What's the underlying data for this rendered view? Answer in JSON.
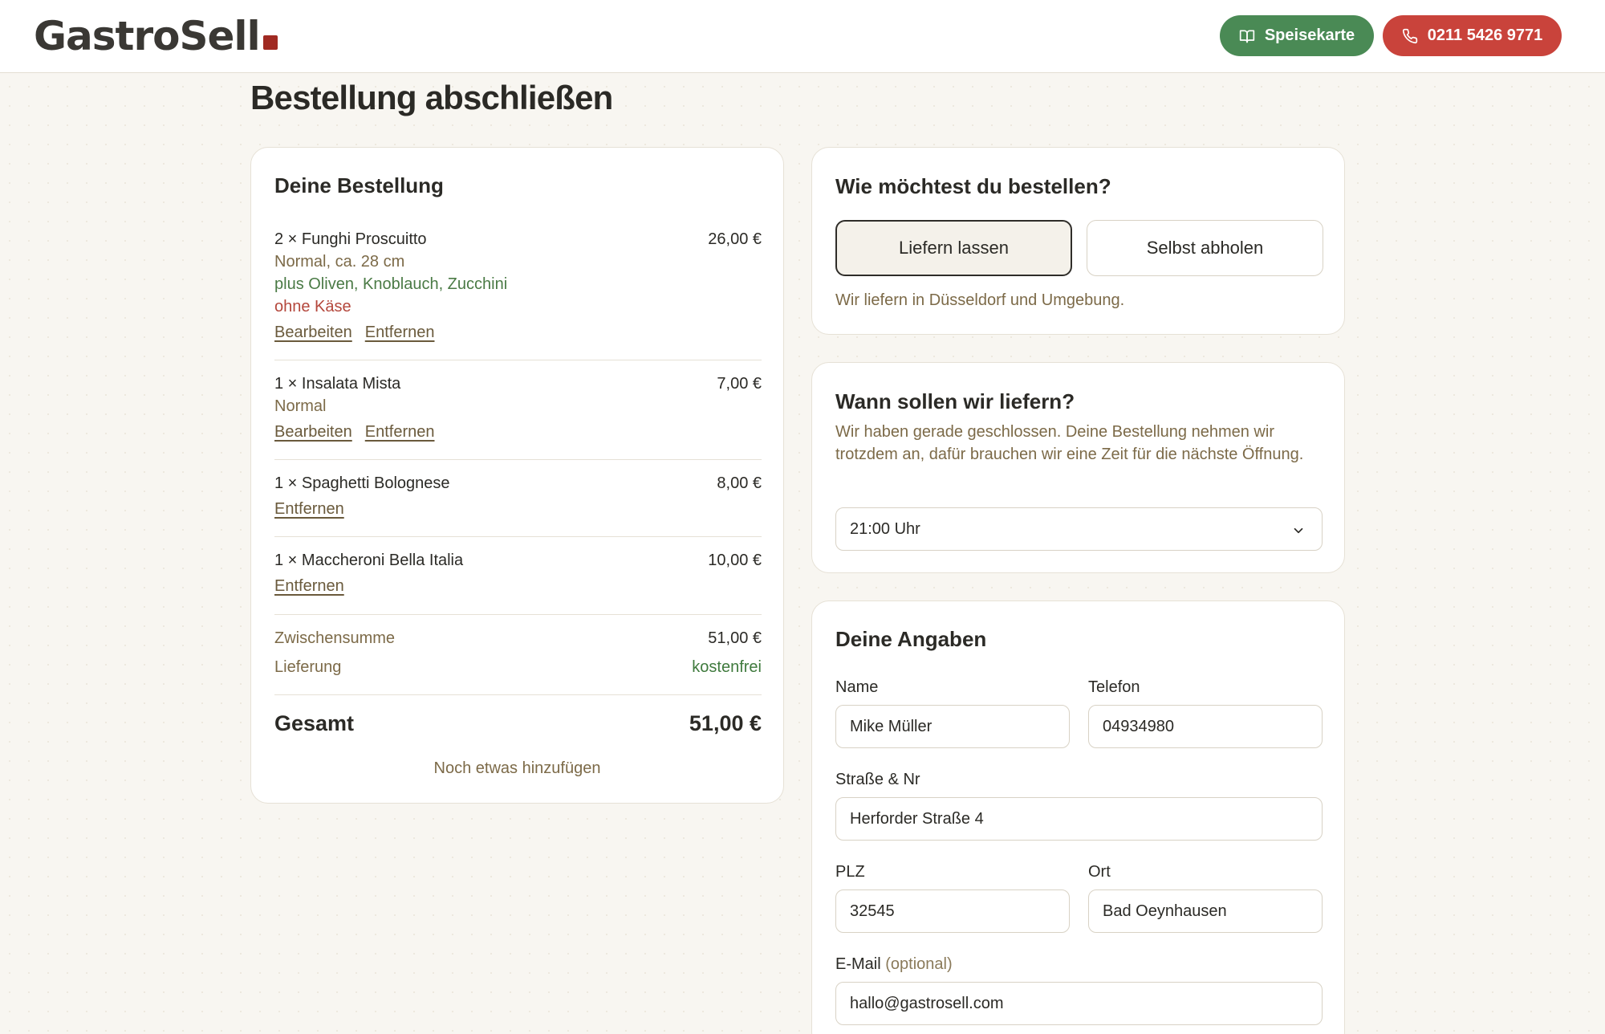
{
  "header": {
    "logo_text": "GastroSell",
    "menu_button": "Speisekarte",
    "phone_button": "0211 5426 9771"
  },
  "page": {
    "title": "Bestellung abschließen"
  },
  "order": {
    "title": "Deine Bestellung",
    "items": [
      {
        "name": "2 × Funghi Proscuitto",
        "price": "26,00 €",
        "size": "Normal, ca. 28 cm",
        "extras": "plus Oliven, Knoblauch, Zucchini",
        "removed": "ohne Käse",
        "edit": "Bearbeiten",
        "remove": "Entfernen"
      },
      {
        "name": "1 × Insalata Mista",
        "price": "7,00 €",
        "size": "Normal",
        "edit": "Bearbeiten",
        "remove": "Entfernen"
      },
      {
        "name": "1 × Spaghetti Bolognese",
        "price": "8,00 €",
        "remove": "Entfernen"
      },
      {
        "name": "1 × Maccheroni Bella Italia",
        "price": "10,00 €",
        "remove": "Entfernen"
      }
    ],
    "subtotal_label": "Zwischensumme",
    "subtotal_value": "51,00 €",
    "delivery_label": "Lieferung",
    "delivery_value": "kostenfrei",
    "total_label": "Gesamt",
    "total_value": "51,00 €",
    "add_more": "Noch etwas hinzufügen"
  },
  "method": {
    "title": "Wie möchtest du bestellen?",
    "delivery": "Liefern lassen",
    "pickup": "Selbst abholen",
    "selected": "delivery",
    "note": "Wir liefern in Düsseldorf und Umgebung."
  },
  "time": {
    "title": "Wann sollen wir liefern?",
    "text": "Wir haben gerade geschlossen. Deine Bestellung nehmen wir trotzdem an, dafür brauchen wir eine Zeit für die nächste Öffnung.",
    "selected": "21:00 Uhr"
  },
  "details": {
    "title": "Deine Angaben",
    "name_label": "Name",
    "name_value": "Mike Müller",
    "phone_label": "Telefon",
    "phone_value": "04934980",
    "street_label": "Straße & Nr",
    "street_value": "Herforder Straße 4",
    "zip_label": "PLZ",
    "zip_value": "32545",
    "city_label": "Ort",
    "city_value": "Bad Oeynhausen",
    "email_label": "E-Mail",
    "email_optional": "(optional)",
    "email_value": "hallo@gastrosell.com"
  },
  "colors": {
    "accent_green": "#4a8a55",
    "accent_red": "#c9433b",
    "background": "#f8f6f1"
  },
  "icons": {
    "menu_button_icon": "book-open-icon",
    "phone_button_icon": "phone-icon",
    "select_icon": "chevron-down-icon"
  }
}
